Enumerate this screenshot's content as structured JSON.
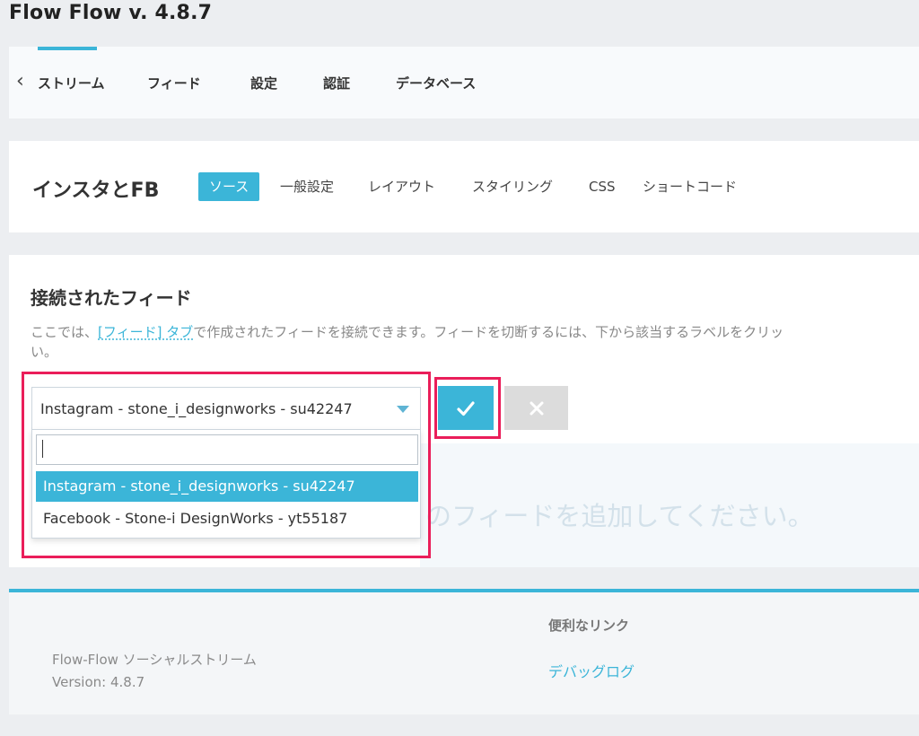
{
  "app": {
    "title": "Flow Flow v. 4.8.7"
  },
  "nav": {
    "back_icon": "chevron-left-icon",
    "items": [
      {
        "label": "ストリーム"
      },
      {
        "label": "フィード"
      },
      {
        "label": "設定"
      },
      {
        "label": "認証"
      },
      {
        "label": "データベース"
      }
    ]
  },
  "stream": {
    "name": "インスタとFB",
    "tabs": [
      {
        "label": "ソース",
        "active": true
      },
      {
        "label": "一般設定"
      },
      {
        "label": "レイアウト"
      },
      {
        "label": "スタイリング"
      },
      {
        "label": "CSS"
      },
      {
        "label": "ショートコード"
      }
    ]
  },
  "connected": {
    "title": "接続されたフィード",
    "desc_before": "ここでは、",
    "desc_link": "[フィード] タブ",
    "desc_after": "で作成されたフィードを接続できます。フィードを切断するには、下から該当するラベルをクリッ",
    "desc_line2": "い。",
    "select_value": "Instagram - stone_i_designworks - su42247",
    "search_placeholder": "",
    "options": [
      {
        "label": "Instagram - stone_i_designworks - su42247",
        "selected": true
      },
      {
        "label": "Facebook - Stone-i DesignWorks - yt55187"
      }
    ],
    "empty_text": "のフィードを追加してください。",
    "confirm_icon": "checkmark-icon",
    "cancel_icon": "close-icon"
  },
  "colors": {
    "accent": "#3bb5d8",
    "highlight": "#ea1e5a",
    "muted_button": "#dcdcdc"
  },
  "footer": {
    "product": "Flow-Flow ソーシャルストリーム",
    "version": "Version: 4.8.7",
    "links_title": "便利なリンク",
    "links": [
      {
        "label": "デバッグログ"
      }
    ]
  }
}
